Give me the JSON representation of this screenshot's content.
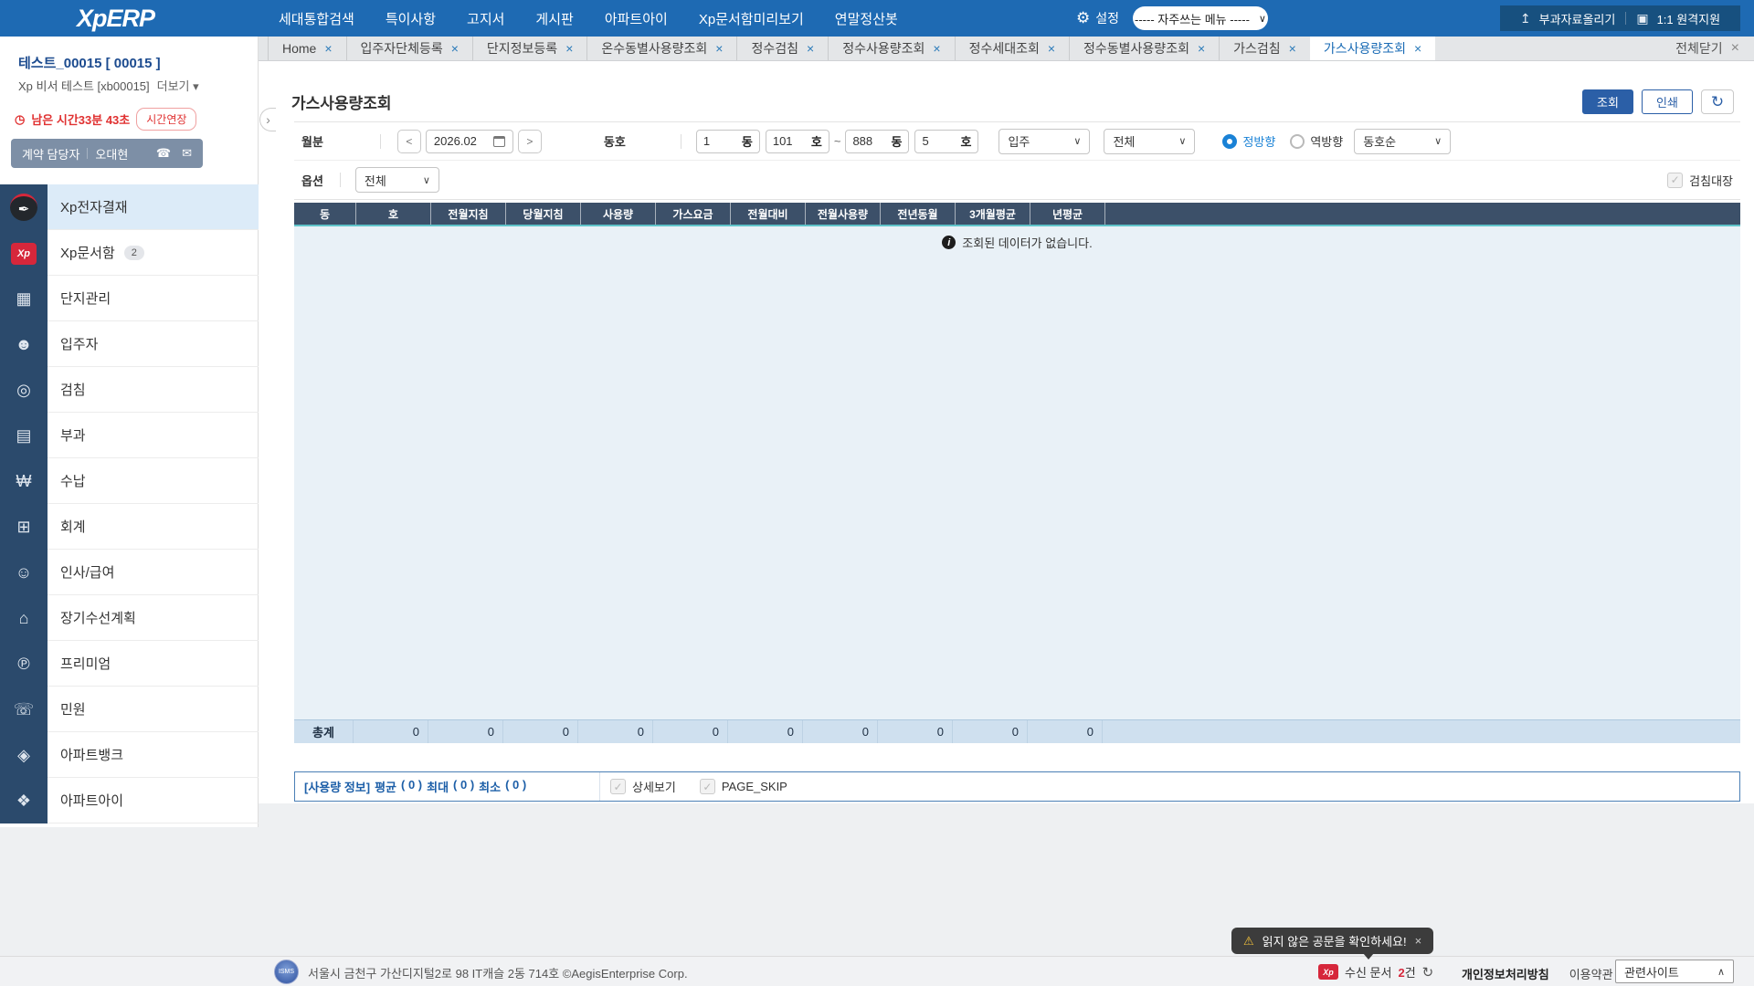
{
  "colors": {
    "topbar_blue": "#1e6ab3",
    "topbar_dark_box": "#17507f",
    "accent_blue": "#1a6bb5",
    "button_blue": "#2b5fa7",
    "table_header_navy": "#3c5069",
    "table_body_blue": "#e9f1f7",
    "total_row_blue": "#cfe0ef",
    "sidebar_icon_navy": "#2b4a6c",
    "active_menu_blue": "#dcebf8",
    "alert_red": "#e03131",
    "badge_red": "#d6273b",
    "teal_line": "#5fc3c9"
  },
  "icons": {
    "gear": "⚙",
    "caret_down": "∨",
    "caret_up": "∧",
    "caret_small": "▾",
    "close": "×",
    "check": "✓",
    "refresh": "↻",
    "clock": "◷",
    "phone": "☎",
    "mail": "✉",
    "info": "i",
    "bell": "⚠",
    "upload": "↥",
    "remote": "▣",
    "collapse": "‹"
  },
  "topbar": {
    "logo": "XpERP",
    "menu": [
      {
        "label": "세대통합검색"
      },
      {
        "label": "특이사항"
      },
      {
        "label": "고지서"
      },
      {
        "label": "게시판"
      },
      {
        "label": "아파트아이"
      },
      {
        "label": "Xp문서함미리보기"
      },
      {
        "label": "연말정산봇"
      }
    ],
    "settings_label": "설정",
    "favorites_dropdown": "----- 자주쓰는 메뉴 -----",
    "upload_label": "부과자료올리기",
    "remote_label": "1:1 원격지원"
  },
  "tabs": {
    "items": [
      {
        "label": "Home"
      },
      {
        "label": "입주자단체등록"
      },
      {
        "label": "단지정보등록"
      },
      {
        "label": "온수동별사용량조회"
      },
      {
        "label": "정수검침"
      },
      {
        "label": "정수사용량조회"
      },
      {
        "label": "정수세대조회"
      },
      {
        "label": "정수동별사용량조회"
      },
      {
        "label": "가스검침"
      },
      {
        "label": "가스사용량조회",
        "active": true
      }
    ],
    "close_all": "전체닫기"
  },
  "sidebar": {
    "site_name": "테스트_00015 [ 00015 ]",
    "user_line": "Xp 비서 테스트 [xb00015]",
    "more_label": "더보기",
    "timer_label": "남은 시간33분 43초",
    "extend_button": "시간연장",
    "contact_role": "계약 담당자",
    "contact_name": "오대현",
    "menu": [
      {
        "label": "Xp전자결재",
        "icon": "approval-pen-icon",
        "glyph": "✒",
        "variant": "pen",
        "active": true
      },
      {
        "label": "Xp문서함",
        "icon": "document-box-icon",
        "glyph": "Xp",
        "variant": "xpbox",
        "badge": "2"
      },
      {
        "label": "단지관리",
        "icon": "complex-building-icon",
        "glyph": "▦"
      },
      {
        "label": "입주자",
        "icon": "residents-icon",
        "glyph": "☻"
      },
      {
        "label": "검침",
        "icon": "meter-reading-icon",
        "glyph": "◎"
      },
      {
        "label": "부과",
        "icon": "billing-icon",
        "glyph": "▤"
      },
      {
        "label": "수납",
        "icon": "receipt-icon",
        "glyph": "₩"
      },
      {
        "label": "회계",
        "icon": "accounting-icon",
        "glyph": "⊞"
      },
      {
        "label": "인사/급여",
        "icon": "hr-payroll-icon",
        "glyph": "☺"
      },
      {
        "label": "장기수선계획",
        "icon": "long-term-plan-icon",
        "glyph": "⌂"
      },
      {
        "label": "프리미엄",
        "icon": "premium-icon",
        "glyph": "℗"
      },
      {
        "label": "민원",
        "icon": "civil-complaint-icon",
        "glyph": "☏"
      },
      {
        "label": "아파트뱅크",
        "icon": "apartment-bank-icon",
        "glyph": "◈"
      },
      {
        "label": "아파트아이",
        "icon": "apartment-i-icon",
        "glyph": "❖"
      }
    ]
  },
  "page": {
    "title": "가스사용량조회",
    "search_button": "조회",
    "print_button": "인쇄"
  },
  "filters": {
    "month_label": "월분",
    "prev": "<",
    "next": ">",
    "month_value": "2026.02",
    "dongho_label": "동호",
    "dong_from": "1",
    "dong_unit": "동",
    "ho_from": "101",
    "ho_unit": "호",
    "range_tilde": "~",
    "dong_to": "888",
    "ho_to": "5",
    "occupancy_select": "입주",
    "state_select": "전체",
    "dir_forward": "정방향",
    "dir_backward": "역방향",
    "sort_select": "동호순",
    "option_label": "옵션",
    "option_select": "전체",
    "meter_book_checkbox": "검침대장"
  },
  "table": {
    "columns": [
      "동",
      "호",
      "전월지침",
      "당월지침",
      "사용량",
      "가스요금",
      "전월대비",
      "전월사용량",
      "전년동월",
      "3개월평균",
      "년평균"
    ],
    "empty_message": "조회된 데이터가 없습니다.",
    "total_label": "총계",
    "total_values": [
      "0",
      "0",
      "0",
      "0",
      "0",
      "0",
      "0",
      "0",
      "0",
      "0"
    ]
  },
  "summary": {
    "prefix": "[사용량 정보]",
    "avg_label": "평균",
    "avg_value": "( 0 )",
    "max_label": "최대",
    "max_value": "( 0 )",
    "min_label": "최소",
    "min_value": "( 0 )",
    "detail_checkbox": "상세보기",
    "pageskip_checkbox": "PAGE_SKIP"
  },
  "toast": {
    "message": "읽지 않은 공문을 확인하세요!"
  },
  "footer": {
    "isms": "ISMS",
    "address": "서울시 금천구 가산디지털2로 98 IT캐슬 2동 714호 ©AegisEnterprise Corp.",
    "received_label": "수신 문서",
    "received_count": "2",
    "received_unit": "건",
    "privacy": "개인정보처리방침",
    "terms": "이용약관",
    "related_sites": "관련사이트"
  }
}
